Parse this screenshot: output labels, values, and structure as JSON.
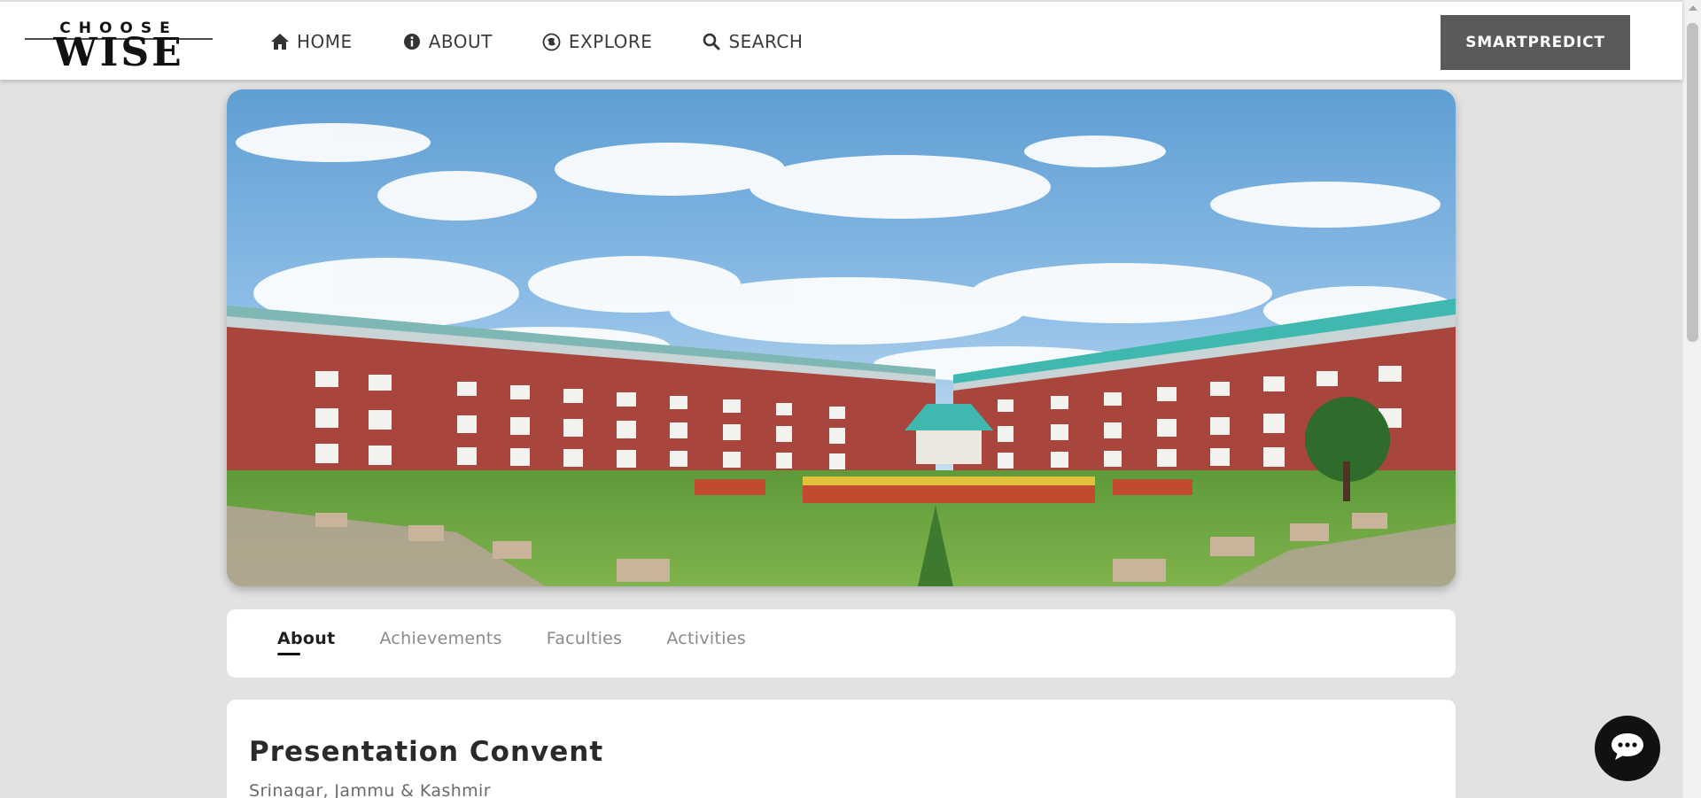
{
  "brand": {
    "logo_top": "CHOOSE",
    "logo_bottom": "WISE"
  },
  "nav": {
    "items": [
      {
        "label": "HOME",
        "icon": "home-icon"
      },
      {
        "label": "ABOUT",
        "icon": "info-icon"
      },
      {
        "label": "EXPLORE",
        "icon": "compass-icon"
      },
      {
        "label": "SEARCH",
        "icon": "search-icon"
      }
    ],
    "cta_label": "SMARTPREDICT"
  },
  "tabs": [
    {
      "label": "About",
      "active": true
    },
    {
      "label": "Achievements",
      "active": false
    },
    {
      "label": "Faculties",
      "active": false
    },
    {
      "label": "Activities",
      "active": false
    }
  ],
  "school": {
    "name": "Presentation Convent",
    "location": "Srinagar, Jammu & Kashmir"
  },
  "chat": {
    "icon": "chat-bubble-icon"
  },
  "colors": {
    "page_bg": "#e2e2e2",
    "nav_bg": "#ffffff",
    "cta_bg": "#5a5a5a",
    "chat_bg": "#111111",
    "building_brick": "#a8463e",
    "roof_teal": "#3fb8b0"
  }
}
